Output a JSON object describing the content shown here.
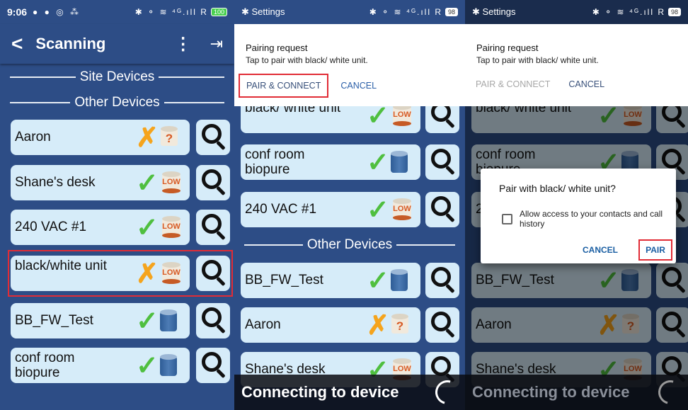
{
  "panel1": {
    "status": {
      "time": "9:06",
      "right": "✱ ⚬ ≋ ⁴ᴳ.ıll R",
      "battery": "100"
    },
    "appbar": {
      "title": "Scanning"
    },
    "sections": {
      "site": "Site Devices",
      "other": "Other Devices"
    },
    "devices": [
      {
        "name": "Aaron",
        "status": "cross",
        "tank": "unknown"
      },
      {
        "name": "Shane's desk",
        "status": "check",
        "tank": "low"
      },
      {
        "name": "240 VAC #1",
        "status": "check",
        "tank": "low"
      },
      {
        "name": "black/white unit",
        "status": "cross",
        "tank": "low"
      },
      {
        "name": "BB_FW_Test",
        "status": "check",
        "tank": "full"
      },
      {
        "name": "conf room biopure",
        "status": "check",
        "tank": "full"
      }
    ]
  },
  "panel2": {
    "status": {
      "left": "✱ Settings",
      "right": "✱ ⚬ ≋ ⁴ᴳ.ıll R",
      "battery": "98"
    },
    "dialog": {
      "heading": "Pairing request",
      "subtext": "Tap to pair with black/ white unit.",
      "pair_connect": "PAIR & CONNECT",
      "cancel": "CANCEL"
    },
    "partial_top": "black/ white unit",
    "devices": [
      {
        "name": "conf room biopure",
        "status": "check",
        "tank": "full"
      },
      {
        "name": "240 VAC #1",
        "status": "check",
        "tank": "low"
      }
    ],
    "other_section": "Other Devices",
    "other_devices": [
      {
        "name": "BB_FW_Test",
        "status": "check",
        "tank": "full"
      },
      {
        "name": "Aaron",
        "status": "cross",
        "tank": "unknown"
      },
      {
        "name": "Shane's desk",
        "status": "check",
        "tank": "low"
      }
    ],
    "connecting": "Connecting to device"
  },
  "panel3": {
    "status": {
      "left": "✱ Settings",
      "right": "✱ ⚬ ≋ ⁴ᴳ.ıll R",
      "battery": "98"
    },
    "dialog": {
      "heading": "Pairing request",
      "subtext": "Tap to pair with black/ white unit.",
      "pair_connect": "PAIR & CONNECT",
      "cancel": "CANCEL"
    },
    "partial_top": "black/ white unit",
    "devices": [
      {
        "name": "conf room biopure",
        "status": "check",
        "tank": "full"
      },
      {
        "name": "240 VAC #1",
        "status": "check",
        "tank": "low"
      }
    ],
    "other_devices": [
      {
        "name": "BB_FW_Test",
        "status": "check",
        "tank": "full"
      },
      {
        "name": "Aaron",
        "status": "cross",
        "tank": "unknown"
      },
      {
        "name": "Shane's desk",
        "status": "check",
        "tank": "low"
      }
    ],
    "pair_dialog": {
      "question": "Pair with black/ white unit?",
      "checkbox_label": "Allow access to your contacts and call history",
      "cancel": "CANCEL",
      "pair": "PAIR"
    },
    "connecting": "Connecting to device"
  },
  "icons": {
    "low_label": "LOW",
    "unknown_label": "?",
    "check": "✓",
    "cross": "✗"
  },
  "colors": {
    "background": "#2d4d86",
    "card": "#d6ecf9",
    "highlight": "#e12c36",
    "check": "#4fbf3f",
    "cross": "#f5a41d"
  }
}
